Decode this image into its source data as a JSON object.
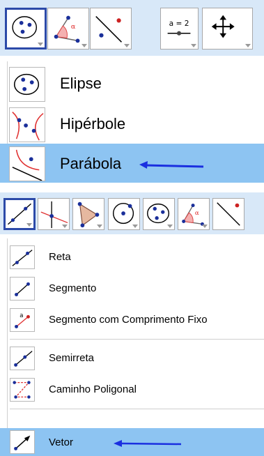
{
  "top_menu": {
    "toolbar_icons": [
      "ellipse-through-points-icon",
      "angle-icon",
      "line-point-icon",
      "slider-icon",
      "move-graphics-icon"
    ],
    "slider_label": "a = 2",
    "items": [
      {
        "label": "Elipse",
        "icon": "ellipse-icon"
      },
      {
        "label": "Hipérbole",
        "icon": "hyperbola-icon"
      },
      {
        "label": "Parábola",
        "icon": "parabola-icon",
        "highlighted": true
      }
    ]
  },
  "bottom_menu": {
    "toolbar_icons": [
      "line-icon",
      "perpendicular-line-icon",
      "polygon-icon",
      "circle-center-point-icon",
      "conic-five-points-icon",
      "angle-icon",
      "line-point-icon"
    ],
    "items": [
      {
        "label": "Reta",
        "icon": "line-icon"
      },
      {
        "label": "Segmento",
        "icon": "segment-icon"
      },
      {
        "label": "Segmento com Comprimento Fixo",
        "icon": "segment-fixed-length-icon"
      },
      {
        "label": "Semirreta",
        "icon": "ray-icon"
      },
      {
        "label": "Caminho Poligonal",
        "icon": "polyline-icon"
      },
      {
        "label": "Vetor",
        "icon": "vector-icon",
        "highlighted": true
      }
    ]
  },
  "colors": {
    "highlight": "#8dc4f2",
    "selected_border": "#2c4aa8",
    "toolbar_bg": "#d8e8f8",
    "annotation_arrow": "#1a2fe0",
    "point": "#1a2f9a",
    "curve": "#e03030"
  }
}
